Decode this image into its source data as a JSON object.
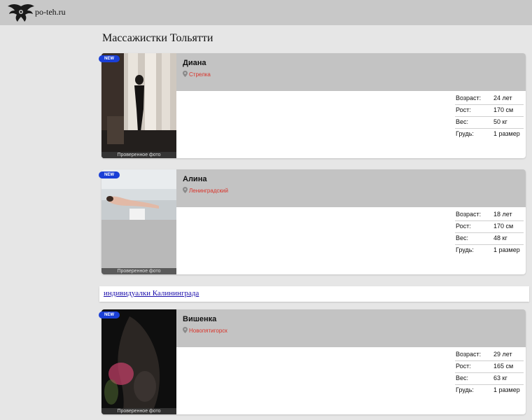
{
  "header": {
    "site_name": "po-teh.ru"
  },
  "page": {
    "title": "Массажистки Тольятти"
  },
  "profiles": [
    {
      "badge": "NEW",
      "name": "Диана",
      "location": "Стрелка",
      "photo_caption": "Проверенное фото",
      "params": [
        {
          "label": "Возраст:",
          "value": "24 лет"
        },
        {
          "label": "Рост:",
          "value": "170 см"
        },
        {
          "label": "Вес:",
          "value": "50 кг"
        },
        {
          "label": "Грудь:",
          "value": "1 размер"
        }
      ]
    },
    {
      "badge": "NEW",
      "name": "Алина",
      "location": "Ленинградский",
      "photo_caption": "Проверенное фото",
      "params": [
        {
          "label": "Возраст:",
          "value": "18 лет"
        },
        {
          "label": "Рост:",
          "value": "170 см"
        },
        {
          "label": "Вес:",
          "value": "48 кг"
        },
        {
          "label": "Грудь:",
          "value": "1 размер"
        }
      ]
    },
    {
      "badge": "NEW",
      "name": "Вишенка",
      "location": "Новопятигорск",
      "photo_caption": "Проверенное фото",
      "params": [
        {
          "label": "Возраст:",
          "value": "29 лет"
        },
        {
          "label": "Рост:",
          "value": "165 см"
        },
        {
          "label": "Вес:",
          "value": "63 кг"
        },
        {
          "label": "Грудь:",
          "value": "1 размер"
        }
      ]
    }
  ],
  "promo_link": {
    "text": "индивидуалки Калининграда"
  },
  "colors": {
    "badge": "#1a3fd6",
    "location": "#d9342b",
    "link": "#1a0dab"
  }
}
